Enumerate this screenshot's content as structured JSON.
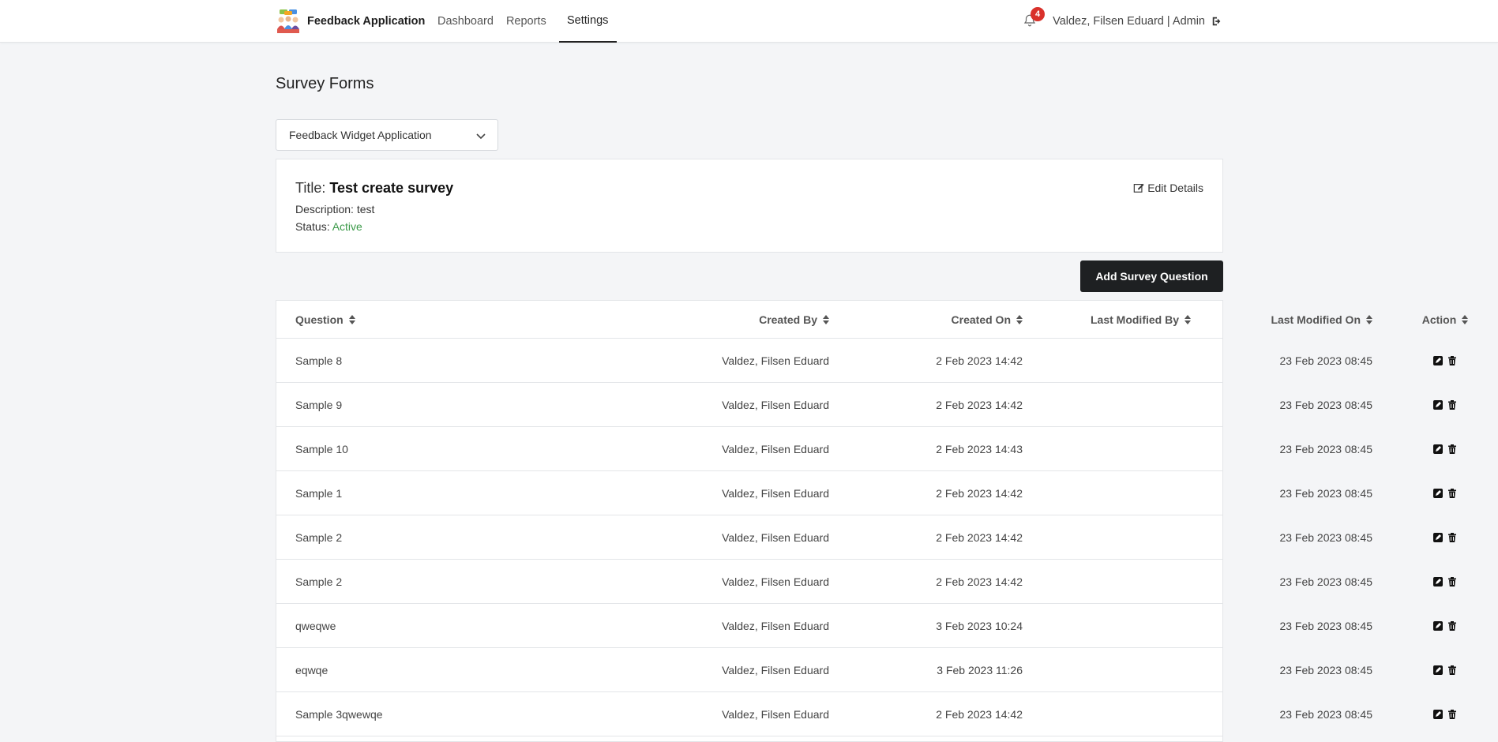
{
  "navbar": {
    "brand": "Feedback Application",
    "links": [
      {
        "label": "Dashboard"
      },
      {
        "label": "Reports"
      },
      {
        "label": "Settings"
      }
    ],
    "active_link": "Settings",
    "notification_count": "4",
    "user": "Valdez, Filsen Eduard | Admin"
  },
  "page": {
    "title": "Survey Forms"
  },
  "app_select": {
    "value": "Feedback Widget Application"
  },
  "survey": {
    "title_label": "Title: ",
    "title_value": "Test create survey",
    "description_label": "Description: ",
    "description_value": "test",
    "status_label": "Status: ",
    "status_value": "Active",
    "edit_label": "Edit Details"
  },
  "add_button": "Add Survey Question",
  "table": {
    "headers": {
      "question": "Question",
      "created_by": "Created By",
      "created_on": "Created On",
      "last_modified_by": "Last Modified By",
      "last_modified_on": "Last Modified On",
      "action": "Action"
    },
    "rows": [
      {
        "question": "Sample 8",
        "created_by": "Valdez, Filsen Eduard",
        "created_on": "2 Feb 2023 14:42",
        "last_modified_by": "",
        "last_modified_on": "23 Feb 2023 08:45"
      },
      {
        "question": "Sample 9",
        "created_by": "Valdez, Filsen Eduard",
        "created_on": "2 Feb 2023 14:42",
        "last_modified_by": "",
        "last_modified_on": "23 Feb 2023 08:45"
      },
      {
        "question": "Sample 10",
        "created_by": "Valdez, Filsen Eduard",
        "created_on": "2 Feb 2023 14:43",
        "last_modified_by": "",
        "last_modified_on": "23 Feb 2023 08:45"
      },
      {
        "question": "Sample 1",
        "created_by": "Valdez, Filsen Eduard",
        "created_on": "2 Feb 2023 14:42",
        "last_modified_by": "",
        "last_modified_on": "23 Feb 2023 08:45"
      },
      {
        "question": "Sample 2",
        "created_by": "Valdez, Filsen Eduard",
        "created_on": "2 Feb 2023 14:42",
        "last_modified_by": "",
        "last_modified_on": "23 Feb 2023 08:45"
      },
      {
        "question": "Sample 2",
        "created_by": "Valdez, Filsen Eduard",
        "created_on": "2 Feb 2023 14:42",
        "last_modified_by": "",
        "last_modified_on": "23 Feb 2023 08:45"
      },
      {
        "question": "qweqwe",
        "created_by": "Valdez, Filsen Eduard",
        "created_on": "3 Feb 2023 10:24",
        "last_modified_by": "",
        "last_modified_on": "23 Feb 2023 08:45"
      },
      {
        "question": "eqwqe",
        "created_by": "Valdez, Filsen Eduard",
        "created_on": "3 Feb 2023 11:26",
        "last_modified_by": "",
        "last_modified_on": "23 Feb 2023 08:45"
      },
      {
        "question": "Sample 3qwewqe",
        "created_by": "Valdez, Filsen Eduard",
        "created_on": "2 Feb 2023 14:42",
        "last_modified_by": "",
        "last_modified_on": "23 Feb 2023 08:45"
      }
    ]
  },
  "colors": {
    "status_active": "#3c9a4a",
    "badge": "#d9312b",
    "primary_button": "#1e2022"
  }
}
